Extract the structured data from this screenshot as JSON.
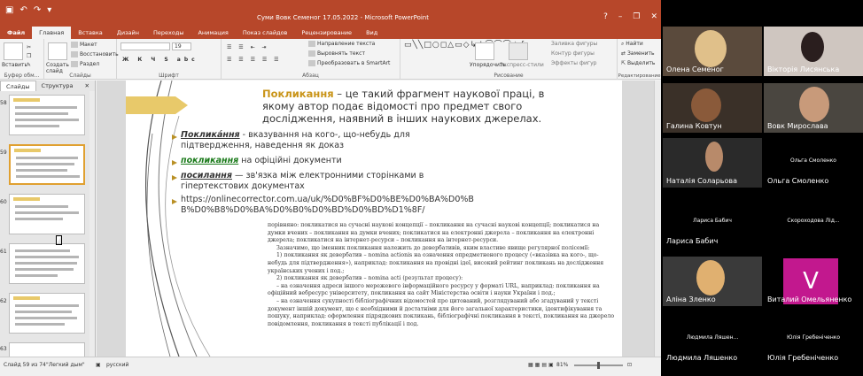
{
  "window": {
    "title": "Суми Вовк Семеног 17.05.2022  -  Microsoft PowerPoint",
    "controls": [
      "?",
      "–",
      "❐",
      "✕"
    ]
  },
  "tabs": [
    {
      "label": "Файл"
    },
    {
      "label": "Главная"
    },
    {
      "label": "Вставка"
    },
    {
      "label": "Дизайн"
    },
    {
      "label": "Переходы"
    },
    {
      "label": "Анимация"
    },
    {
      "label": "Показ слайдов"
    },
    {
      "label": "Рецензирование"
    },
    {
      "label": "Вид"
    }
  ],
  "ribbon": {
    "paste": "Вставить",
    "create_slide": "Создать слайд",
    "layout": "Макет",
    "restore": "Восстановить",
    "section": "Раздел",
    "font_size": "19",
    "text_direction": "Направление текста",
    "align_text": "Выровнять текст",
    "smartart": "Преобразовать в SmartArt",
    "arrange": "Упорядочить",
    "quick_styles": "Экспресс-стили",
    "shape_fill": "Заливка фигуры",
    "shape_outline": "Контур фигуры",
    "shape_effects": "Эффекты фигур",
    "find": "Найти",
    "replace": "Заменить",
    "select": "Выделить",
    "groups": {
      "clipboard": "Буфер обм...",
      "slides": "Слайды",
      "font": "Шрифт",
      "paragraph": "Абзац",
      "drawing": "Рисование",
      "editing": "Редактирование"
    }
  },
  "left_pane": {
    "tabs": [
      "Слайды",
      "Структура"
    ],
    "thumb_numbers": [
      "58",
      "59",
      "60",
      "61",
      "62",
      "63"
    ]
  },
  "slide": {
    "heading_kw": "Покликання",
    "heading_rest": " – це такий фрагмент наукової праці, в якому автор подає відомості про предмет свого дослідження, наявний в інших наукових джерелах.",
    "b1_kw": "Покликáння",
    "b1_rest": " - вказування на кого-, що-небудь для підтвердження, наведення як доказ",
    "b2_kw": "покликання",
    "b2_rest": " на офіційні документи",
    "b3_kw": "посилання",
    "b3_rest": " — зв'язка між електронними сторінками в гіпертекстових документах",
    "b4": "https://onlinecorrector.com.ua/uk/%D0%BF%D0%BE%D0%BA%D0%BB%D0%B8%D0%BA%D0%B0%D0%BD%D0%BD%D1%8F/",
    "scan": [
      "порівняно: покликатися на сучасні наукові концепції – покликання на сучасні наукові концепції; покликатися на думки вчених – покликання на думки вчених; покликатися на електронні джерела – покликання на електронні джерела; покликатися на інтернет-ресурси – покликання на інтернет-ресурси.",
      "Зазначимо, що іменник покликання належить до девербативів, яким властиве явище регулярної полісемії:",
      "1) покликання як девербатив – nomina actionis на означення опредметненого процесу («вказівка на кого-, що-небудь для підтвердження»), наприклад: покликання на провідні ідеї, високий рейтинг покликань на дослідження українських учених і под.;",
      "2) покликання як девербатив – nomina acti (результат процесу):",
      "– на означення адреси іншого мережевого інформаційного ресурсу у форматі URL, наприклад: покликання на офіційний вебресурс університету, покликання на сайт Міністерства освіти і науки України і под.;",
      "– на означення сукупності бібліографічних відомостей про цитований, розглядуваний або згадуваний у тексті документ іншій документ, що є необхідними й достатніми для його загальної характеристики, ідентифікування та пошуку, наприклад: оформлення підрядкових покликань, бібліографічні покликання в тексті, покликання на джерело повідомлення, покликання в тексті публікації і под."
    ]
  },
  "status": {
    "slide": "Слайд 59 из 74",
    "theme": "\"Легкий дым\"",
    "lang": "русский",
    "zoom": "81%",
    "zoom_fraction": 0.5
  },
  "participants": [
    {
      "name": "Олена Семеног",
      "center": ""
    },
    {
      "name": "Вікторія Лисянська",
      "center": ""
    },
    {
      "name": "Галина Ковтун",
      "center": ""
    },
    {
      "name": "Вовк Мирослава",
      "center": ""
    },
    {
      "name": "Наталія Соларьова",
      "center": ""
    },
    {
      "name": "Ольга Смоленко",
      "center": "Ольга Смоленко"
    },
    {
      "name": "Лариса Бабич",
      "center": "Лариса Бабич"
    },
    {
      "name": "",
      "center": "Скороходова  Лід..."
    },
    {
      "name": "Аліна Зленко",
      "center": ""
    },
    {
      "name": "Виталий Омельяненко",
      "center": ""
    },
    {
      "name": "Людмила Ляшенко",
      "center": "Людмила Ляшен..."
    },
    {
      "name": "Юлія Гребенiченко",
      "center": "Юлія Гребенiченко"
    }
  ],
  "avatar_letter": "V",
  "colors": {
    "ppt_accent": "#b7472a",
    "slide_accent": "#e8c96a",
    "avatar": "#c2188e"
  }
}
